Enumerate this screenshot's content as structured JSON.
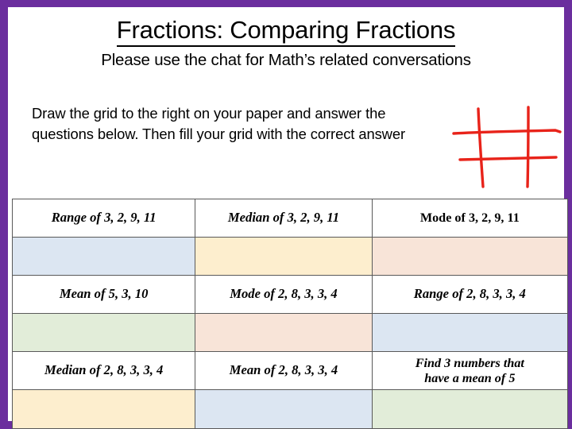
{
  "slide": {
    "border_color": "#6B2E9E",
    "background": "#FFFFFF",
    "title": "Fractions: Comparing Fractions",
    "subtitle": "Please use the chat for Math’s related conversations",
    "instructions": "Draw the grid to the right on your paper and answer the questions below. Then fill your grid with the correct answer",
    "drawing": {
      "name": "hand-drawn-red-grid",
      "color": "#E8231A",
      "description": "Hand drawn red hashtag / tic-tac-toe grid with two vertical and two horizontal strokes"
    }
  },
  "table": {
    "fill_colors": {
      "blue": "#DCE6F2",
      "yellow": "#FDEECE",
      "peach": "#F8E4D8",
      "green": "#E2EDD9"
    },
    "rows": [
      {
        "type": "questions",
        "cells": [
          {
            "text": "Range of 3, 2, 9, 11",
            "style": "italic"
          },
          {
            "text": "Median of 3, 2, 9, 11",
            "style": "italic"
          },
          {
            "text": "Mode of 3, 2, 9, 11",
            "style": "upright"
          }
        ]
      },
      {
        "type": "answers",
        "cells": [
          {
            "text": "",
            "fill": "blue"
          },
          {
            "text": "",
            "fill": "yellow"
          },
          {
            "text": "",
            "fill": "peach"
          }
        ]
      },
      {
        "type": "questions",
        "cells": [
          {
            "text": "Mean of 5, 3, 10",
            "style": "italic"
          },
          {
            "text": "Mode of 2, 8, 3, 3, 4",
            "style": "italic"
          },
          {
            "text": "Range of 2, 8, 3, 3, 4",
            "style": "italic"
          }
        ]
      },
      {
        "type": "answers",
        "cells": [
          {
            "text": "",
            "fill": "green"
          },
          {
            "text": "",
            "fill": "peach"
          },
          {
            "text": "",
            "fill": "blue"
          }
        ]
      },
      {
        "type": "questions",
        "cells": [
          {
            "text": "Median of 2, 8, 3, 3, 4",
            "style": "italic"
          },
          {
            "text": "Mean of 2, 8, 3, 3, 4",
            "style": "italic"
          },
          {
            "text": "Find 3 numbers that have a mean of 5",
            "style": "italic-two-line",
            "line1": "Find 3 numbers that",
            "line2": "have a mean of 5"
          }
        ]
      },
      {
        "type": "answers",
        "cells": [
          {
            "text": "",
            "fill": "yellow"
          },
          {
            "text": "",
            "fill": "blue"
          },
          {
            "text": "",
            "fill": "green"
          }
        ]
      }
    ]
  }
}
